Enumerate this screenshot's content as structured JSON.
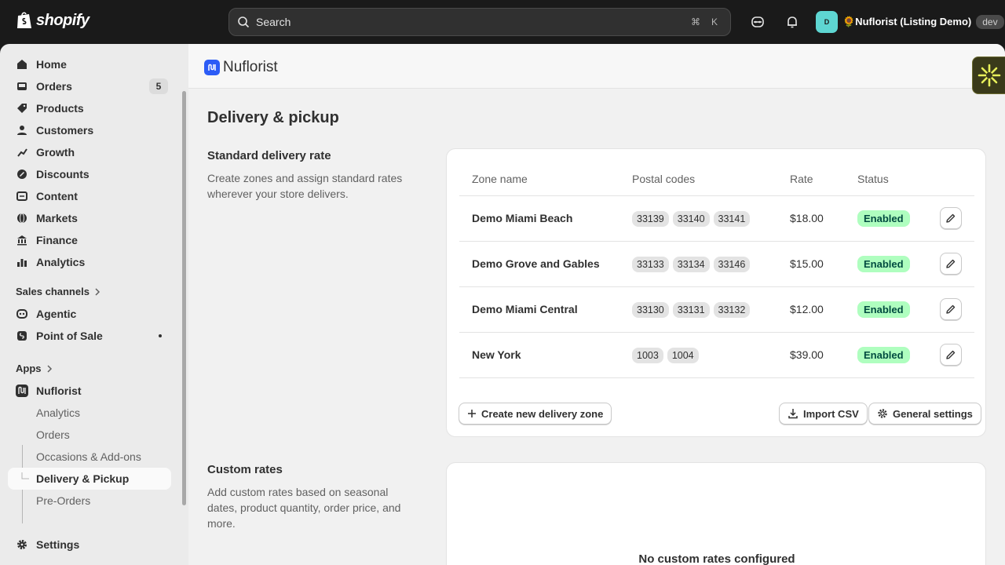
{
  "topbar": {
    "logo_text": "shopify",
    "search_placeholder": "Search",
    "shortcut_cmd": "⌘",
    "shortcut_key": "K",
    "store_avatar": "D",
    "store_name": "🌻Nuflorist (Listing Demo)",
    "store_badge": "dev"
  },
  "sidebar": {
    "items": [
      {
        "label": "Home",
        "icon": "home-icon"
      },
      {
        "label": "Orders",
        "icon": "inbox-icon",
        "badge": "5"
      },
      {
        "label": "Products",
        "icon": "tag-icon"
      },
      {
        "label": "Customers",
        "icon": "person-icon"
      },
      {
        "label": "Growth",
        "icon": "growth-icon"
      },
      {
        "label": "Discounts",
        "icon": "discount-icon"
      },
      {
        "label": "Content",
        "icon": "content-icon"
      },
      {
        "label": "Markets",
        "icon": "globe-icon"
      },
      {
        "label": "Finance",
        "icon": "bank-icon"
      },
      {
        "label": "Analytics",
        "icon": "chart-icon"
      }
    ],
    "sales_channels_label": "Sales channels",
    "channels": [
      {
        "label": "Agentic",
        "icon": "agentic-icon"
      },
      {
        "label": "Point of Sale",
        "icon": "pos-icon"
      }
    ],
    "apps_label": "Apps",
    "app": {
      "label": "Nuflorist",
      "icon": "nuflorist-icon"
    },
    "app_sub": [
      "Analytics",
      "Orders",
      "Occasions & Add-ons",
      "Delivery & Pickup",
      "Pre-Orders"
    ],
    "active_sub": "Delivery & Pickup",
    "settings_label": "Settings"
  },
  "app_header": {
    "name": "Nuflorist"
  },
  "page": {
    "title": "Delivery & pickup",
    "standard": {
      "title": "Standard delivery rate",
      "desc": "Create zones and assign standard rates wherever your store delivers."
    },
    "table": {
      "headers": [
        "Zone name",
        "Postal codes",
        "Rate",
        "Status"
      ],
      "rows": [
        {
          "zone": "Demo Miami Beach",
          "codes": [
            "33139",
            "33140",
            "33141"
          ],
          "rate": "$18.00",
          "status": "Enabled"
        },
        {
          "zone": "Demo Grove and Gables",
          "codes": [
            "33133",
            "33134",
            "33146"
          ],
          "rate": "$15.00",
          "status": "Enabled"
        },
        {
          "zone": "Demo Miami Central",
          "codes": [
            "33130",
            "33131",
            "33132"
          ],
          "rate": "$12.00",
          "status": "Enabled"
        },
        {
          "zone": "New York",
          "codes": [
            "1003",
            "1004"
          ],
          "rate": "$39.00",
          "status": "Enabled"
        }
      ]
    },
    "buttons": {
      "create_zone": "Create new delivery zone",
      "import_csv": "Import CSV",
      "general_settings": "General settings"
    },
    "custom": {
      "title": "Custom rates",
      "desc": "Add custom rates based on seasonal dates, product quantity, order price, and more.",
      "empty_title": "No custom rates configured"
    }
  },
  "colors": {
    "brand": "#2c5cf6",
    "enabled_bg": "#affebf",
    "enabled_text": "#014b40"
  }
}
